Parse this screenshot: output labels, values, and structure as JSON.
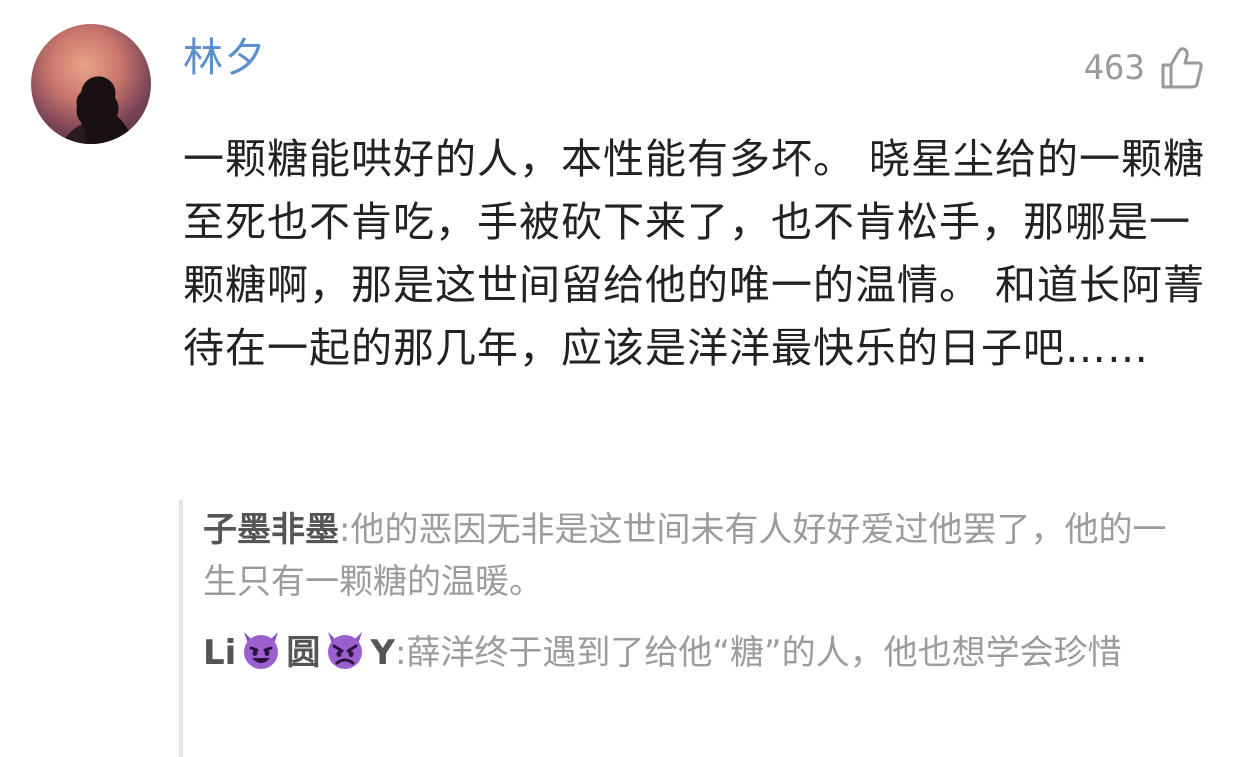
{
  "comment": {
    "username": "林夕",
    "like_count": "463",
    "like_icon": "thumbs-up-icon",
    "text": "一颗糖能哄好的人，本性能有多坏。 晓星尘给的一颗糖至死也不肯吃，手被砍下来了，也不肯松手，那哪是一颗糖啊，那是这世间留给他的唯一的温情。 和道长阿菁待在一起的那几年，应该是洋洋最快乐的日子吧……"
  },
  "replies": [
    {
      "name": "子墨非墨",
      "separator": ":",
      "text": "他的恶因无非是这世间未有人好好爱过他罢了，他的一生只有一颗糖的温暖。"
    },
    {
      "name_part1": "Li",
      "name_emoji1": "smiling-devil-emoji",
      "name_part2": "圆",
      "name_emoji2": "angry-devil-emoji",
      "name_part3": "Y",
      "separator": ":",
      "text": "薛洋终于遇到了给他“糖”的人，他也想学会珍惜"
    }
  ],
  "colors": {
    "username": "#5b8fcb",
    "body_text": "#222222",
    "reply_text": "#9c9c9c",
    "reply_name": "#555555",
    "like": "#9a9a9a"
  }
}
